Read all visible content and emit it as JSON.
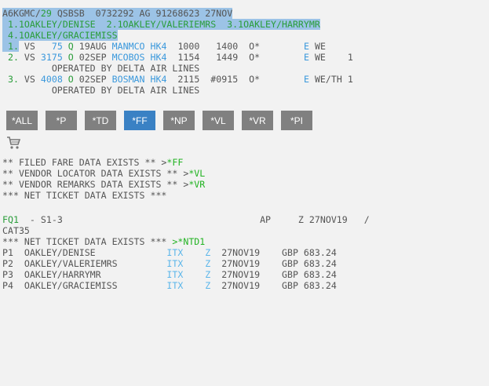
{
  "pnr_lines": [
    {
      "hl": true,
      "segments": [
        {
          "t": "A6KGMC/",
          "c": "d"
        },
        {
          "t": "29",
          "c": "g"
        },
        {
          "t": " QSBSB  0732292 AG 91268623 27NOV",
          "c": "d"
        }
      ]
    },
    {
      "hl": true,
      "segments": [
        {
          "t": " 1.1OAKLEY/DENISE  2.1OAKLEY/VALERIEMRS  3.1OAKLEY/HARRYMR",
          "c": "g"
        }
      ]
    },
    {
      "hl": true,
      "segments": [
        {
          "t": " 4.1OAKLEY/GRACIEMISS",
          "c": "g"
        }
      ]
    },
    {
      "hl_first": true,
      "segments": [
        {
          "t": " 1.",
          "c": "g"
        },
        {
          "t": " VS   ",
          "c": "d"
        },
        {
          "t": "75",
          "c": "b"
        },
        {
          "t": " ",
          "c": "d"
        },
        {
          "t": "Q",
          "c": "g"
        },
        {
          "t": " 19AUG ",
          "c": "d"
        },
        {
          "t": "MANMCO",
          "c": "b"
        },
        {
          "t": " ",
          "c": "d"
        },
        {
          "t": "HK4",
          "c": "b"
        },
        {
          "t": "  1000   1400  O*        ",
          "c": "d"
        },
        {
          "t": "E",
          "c": "b"
        },
        {
          "t": " WE",
          "c": "d"
        }
      ]
    },
    {
      "segments": [
        {
          "t": " 2.",
          "c": "g"
        },
        {
          "t": " VS ",
          "c": "d"
        },
        {
          "t": "3175",
          "c": "b"
        },
        {
          "t": " ",
          "c": "d"
        },
        {
          "t": "O",
          "c": "g"
        },
        {
          "t": " 02SEP ",
          "c": "d"
        },
        {
          "t": "MCOBOS",
          "c": "b"
        },
        {
          "t": " ",
          "c": "d"
        },
        {
          "t": "HK4",
          "c": "b"
        },
        {
          "t": "  1154   1449  O*        ",
          "c": "d"
        },
        {
          "t": "E",
          "c": "b"
        },
        {
          "t": " WE    1",
          "c": "d"
        }
      ]
    },
    {
      "segments": [
        {
          "t": "         OPERATED BY DELTA AIR LINES",
          "c": "d"
        }
      ]
    },
    {
      "segments": [
        {
          "t": " 3.",
          "c": "g"
        },
        {
          "t": " VS ",
          "c": "d"
        },
        {
          "t": "4008",
          "c": "b"
        },
        {
          "t": " ",
          "c": "d"
        },
        {
          "t": "O",
          "c": "g"
        },
        {
          "t": " 02SEP ",
          "c": "d"
        },
        {
          "t": "BOSMAN",
          "c": "b"
        },
        {
          "t": " ",
          "c": "d"
        },
        {
          "t": "HK4",
          "c": "b"
        },
        {
          "t": "  2115  #0915  O*        ",
          "c": "d"
        },
        {
          "t": "E",
          "c": "b"
        },
        {
          "t": " WE/TH 1",
          "c": "d"
        }
      ]
    },
    {
      "segments": [
        {
          "t": "         OPERATED BY DELTA AIR LINES",
          "c": "d"
        }
      ]
    }
  ],
  "buttons": [
    {
      "label": "*ALL",
      "active": false
    },
    {
      "label": "*P",
      "active": false
    },
    {
      "label": "*TD",
      "active": false
    },
    {
      "label": "*FF",
      "active": true
    },
    {
      "label": "*NP",
      "active": false
    },
    {
      "label": "*VL",
      "active": false
    },
    {
      "label": "*VR",
      "active": false
    },
    {
      "label": "*PI",
      "active": false
    }
  ],
  "cart_icon": "shopping-cart-icon",
  "message_lines": [
    {
      "segments": [
        {
          "t": "** FILED FARE DATA EXISTS ** >",
          "c": "d"
        },
        {
          "t": "*FF",
          "c": "bg",
          "link": true
        }
      ]
    },
    {
      "segments": [
        {
          "t": "** VENDOR LOCATOR DATA EXISTS ** >",
          "c": "d"
        },
        {
          "t": "*VL",
          "c": "bg",
          "link": true
        }
      ]
    },
    {
      "segments": [
        {
          "t": "** VENDOR REMARKS DATA EXISTS ** >",
          "c": "d"
        },
        {
          "t": "*VR",
          "c": "bg",
          "link": true
        }
      ]
    },
    {
      "segments": [
        {
          "t": "*** NET TICKET DATA EXISTS ***",
          "c": "d"
        }
      ]
    }
  ],
  "fare_lines": [
    {
      "segments": [
        {
          "t": "FQ1",
          "c": "g",
          "link": true
        },
        {
          "t": "  - S1-3                                    AP     Z 27NOV19   /",
          "c": "d"
        }
      ]
    },
    {
      "segments": [
        {
          "t": "CAT35",
          "c": "d"
        }
      ]
    },
    {
      "segments": [
        {
          "t": "*** NET TICKET DATA EXISTS *** ",
          "c": "d"
        },
        {
          "t": ">*NTD1",
          "c": "bg",
          "link": true
        }
      ]
    },
    {
      "segments": [
        {
          "t": "P1  OAKLEY/DENISE             ",
          "c": "d"
        },
        {
          "t": "ITX",
          "c": "lb"
        },
        {
          "t": "    ",
          "c": "d"
        },
        {
          "t": "Z",
          "c": "lb"
        },
        {
          "t": "  27NOV19    GBP 683.24",
          "c": "d"
        }
      ]
    },
    {
      "segments": [
        {
          "t": "P2  OAKLEY/VALERIEMRS         ",
          "c": "d"
        },
        {
          "t": "ITX",
          "c": "lb"
        },
        {
          "t": "    ",
          "c": "d"
        },
        {
          "t": "Z",
          "c": "lb"
        },
        {
          "t": "  27NOV19    GBP 683.24",
          "c": "d"
        }
      ]
    },
    {
      "segments": [
        {
          "t": "P3  OAKLEY/HARRYMR            ",
          "c": "d"
        },
        {
          "t": "ITX",
          "c": "lb"
        },
        {
          "t": "    ",
          "c": "d"
        },
        {
          "t": "Z",
          "c": "lb"
        },
        {
          "t": "  27NOV19    GBP 683.24",
          "c": "d"
        }
      ]
    },
    {
      "segments": [
        {
          "t": "P4  OAKLEY/GRACIEMISS         ",
          "c": "d"
        },
        {
          "t": "ITX",
          "c": "lb"
        },
        {
          "t": "    ",
          "c": "d"
        },
        {
          "t": "Z",
          "c": "lb"
        },
        {
          "t": "  27NOV19    GBP 683.24",
          "c": "d"
        }
      ]
    }
  ]
}
